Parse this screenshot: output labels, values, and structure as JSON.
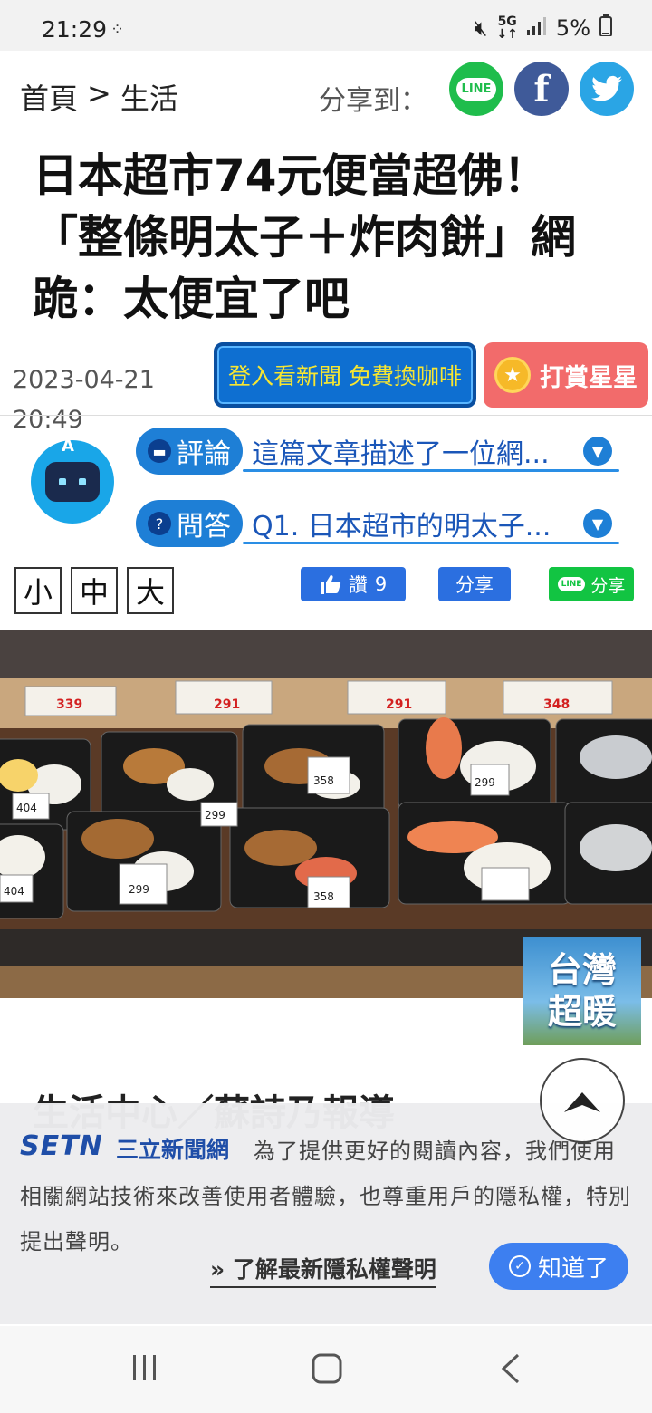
{
  "status_bar": {
    "time": "21:29",
    "net_top": "5G",
    "net_bottom": "↓↑",
    "battery": "5%"
  },
  "header": {
    "breadcrumb": [
      "首頁",
      ">",
      "生活"
    ],
    "share_label": "分享到：",
    "social": {
      "line": "LINE",
      "facebook": "f"
    }
  },
  "article": {
    "title": "日本超市74元便當超佛！「整條明太子＋炸肉餅」網跪：太便宜了吧",
    "date": "2023-04-21",
    "time": "20:49",
    "body_start": "生活中心／蘇詩乃報導"
  },
  "buttons": {
    "login_label": "登入看新聞 免費換咖啡",
    "star_label": "打賞星星"
  },
  "ai_box": {
    "robot_label": "A",
    "comment_tab": "評論",
    "comment_text": "這篇文章描述了一位網...",
    "qa_tab": "問答",
    "qa_text": "Q1. 日本超市的明太子..."
  },
  "font_size": {
    "small": "小",
    "medium": "中",
    "large": "大"
  },
  "social_actions": {
    "like_label": "讚",
    "like_count": "9",
    "share_label": "分享",
    "line_share_label": "分享",
    "line_mini": "LINE"
  },
  "photo": {
    "price_tags": [
      "339",
      "291",
      "291",
      "348",
      "404",
      "299",
      "358",
      "299",
      "404",
      "299",
      "358"
    ]
  },
  "badge": {
    "line1": "台灣",
    "line2": "超暖"
  },
  "privacy": {
    "logo": "SETN",
    "brand": "三立新聞網",
    "text": "為了提供更好的閱讀內容，我們使用相關網站技術來改善使用者體驗，也尊重用戶的隱私權，特別提出聲明。",
    "link": "了解最新隱私權聲明",
    "ok_label": "知道了"
  },
  "colors": {
    "accent_blue": "#2b6fe0",
    "line_green": "#12c442",
    "star_red": "#f26b6b",
    "brand_blue": "#1f4ea8"
  }
}
